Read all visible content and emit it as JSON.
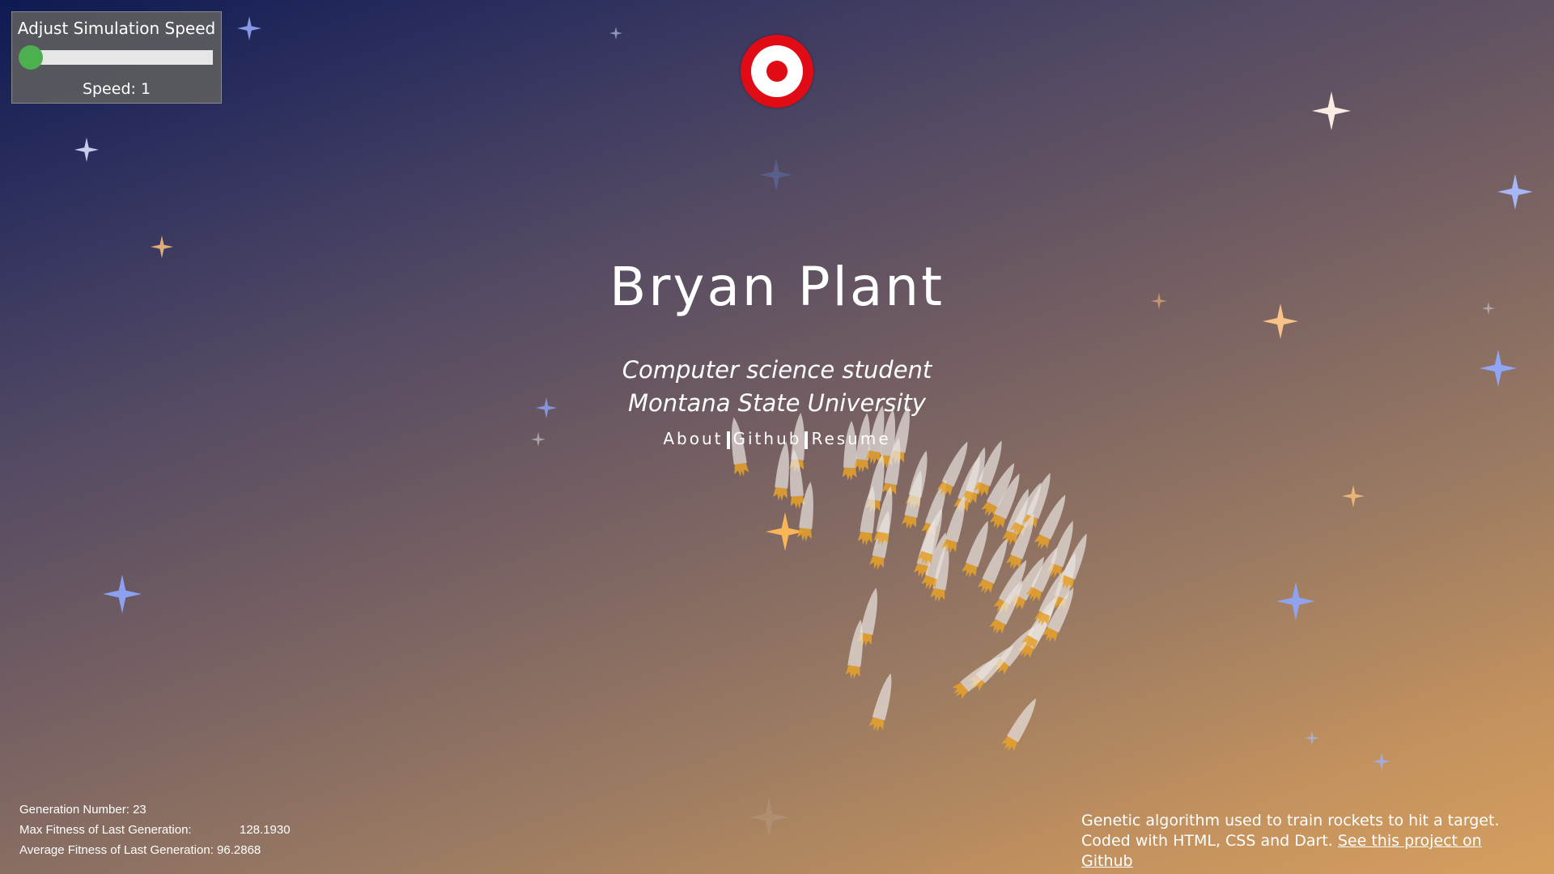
{
  "speed_control": {
    "title": "Adjust Simulation Speed",
    "speed_label": "Speed:",
    "speed_value": 1,
    "slider_fraction": 0.0,
    "knob_color": "#4caf50"
  },
  "target": {
    "outer_color": "#e10b16",
    "ring_color": "#ffffff"
  },
  "hero": {
    "name": "Bryan Plant",
    "subtitle_line1": "Computer science student",
    "subtitle_line2": "Montana State University"
  },
  "nav": {
    "about": "About",
    "github": "Github",
    "resume": "Resume"
  },
  "stats": {
    "generation_label": "Generation Number:",
    "generation_value": "23",
    "max_fitness_label": "Max Fitness of Last Generation:",
    "max_fitness_value": "128.1930",
    "avg_fitness_label": "Average Fitness of Last Generation:",
    "avg_fitness_value": "96.2868"
  },
  "footer": {
    "line1": "Genetic algorithm used to train rockets to hit a target.",
    "line2": "Coded with HTML, CSS and Dart.",
    "link_text": "See this project on Github"
  },
  "colors": {
    "star_blue": "#8fa4f7",
    "star_orange": "#f3b97a",
    "star_white": "#ffffff",
    "rocket_body": "#e9e4e0",
    "rocket_flame": "#e8a22a"
  }
}
